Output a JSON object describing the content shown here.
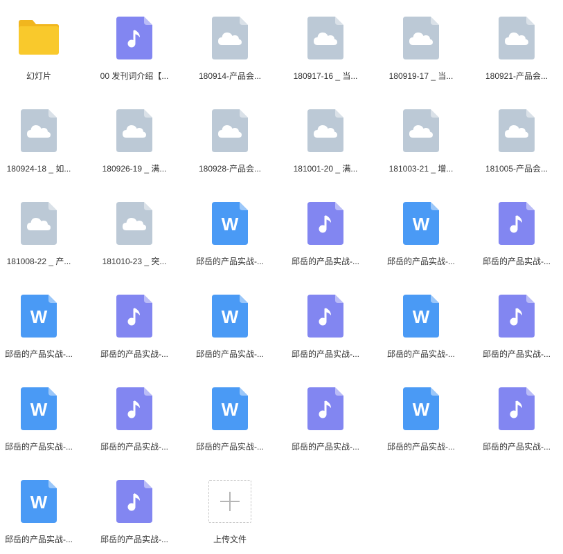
{
  "colors": {
    "folder": "#F9C92C",
    "folder_tab": "#F1B61E",
    "audio": "#8286F1",
    "word": "#4A9AF5",
    "unknown": "#BCC9D6"
  },
  "items": [
    {
      "label": "幻灯片",
      "type": "folder",
      "icon": "folder-icon"
    },
    {
      "label": "00 发刊词介绍【...",
      "type": "audio",
      "icon": "music-note-icon"
    },
    {
      "label": "180914-产品会...",
      "type": "unknown",
      "icon": "cloud-file-icon"
    },
    {
      "label": "180917-16 _ 当...",
      "type": "unknown",
      "icon": "cloud-file-icon"
    },
    {
      "label": "180919-17 _ 当...",
      "type": "unknown",
      "icon": "cloud-file-icon"
    },
    {
      "label": "180921-产品会...",
      "type": "unknown",
      "icon": "cloud-file-icon"
    },
    {
      "label": "180924-18 _ 如...",
      "type": "unknown",
      "icon": "cloud-file-icon"
    },
    {
      "label": "180926-19 _ 满...",
      "type": "unknown",
      "icon": "cloud-file-icon"
    },
    {
      "label": "180928-产品会...",
      "type": "unknown",
      "icon": "cloud-file-icon"
    },
    {
      "label": "181001-20 _ 满...",
      "type": "unknown",
      "icon": "cloud-file-icon"
    },
    {
      "label": "181003-21 _ 增...",
      "type": "unknown",
      "icon": "cloud-file-icon"
    },
    {
      "label": "181005-产品会...",
      "type": "unknown",
      "icon": "cloud-file-icon"
    },
    {
      "label": "181008-22 _ 产...",
      "type": "unknown",
      "icon": "cloud-file-icon"
    },
    {
      "label": "181010-23 _ 突...",
      "type": "unknown",
      "icon": "cloud-file-icon"
    },
    {
      "label": "邱岳的产品实战-...",
      "type": "word",
      "icon": "word-doc-icon"
    },
    {
      "label": "邱岳的产品实战-...",
      "type": "audio",
      "icon": "music-note-icon"
    },
    {
      "label": "邱岳的产品实战-...",
      "type": "word",
      "icon": "word-doc-icon"
    },
    {
      "label": "邱岳的产品实战-...",
      "type": "audio",
      "icon": "music-note-icon"
    },
    {
      "label": "邱岳的产品实战-...",
      "type": "word",
      "icon": "word-doc-icon"
    },
    {
      "label": "邱岳的产品实战-...",
      "type": "audio",
      "icon": "music-note-icon"
    },
    {
      "label": "邱岳的产品实战-...",
      "type": "word",
      "icon": "word-doc-icon"
    },
    {
      "label": "邱岳的产品实战-...",
      "type": "audio",
      "icon": "music-note-icon"
    },
    {
      "label": "邱岳的产品实战-...",
      "type": "word",
      "icon": "word-doc-icon"
    },
    {
      "label": "邱岳的产品实战-...",
      "type": "audio",
      "icon": "music-note-icon"
    },
    {
      "label": "邱岳的产品实战-...",
      "type": "word",
      "icon": "word-doc-icon"
    },
    {
      "label": "邱岳的产品实战-...",
      "type": "audio",
      "icon": "music-note-icon"
    },
    {
      "label": "邱岳的产品实战-...",
      "type": "word",
      "icon": "word-doc-icon"
    },
    {
      "label": "邱岳的产品实战-...",
      "type": "audio",
      "icon": "music-note-icon"
    },
    {
      "label": "邱岳的产品实战-...",
      "type": "word",
      "icon": "word-doc-icon"
    },
    {
      "label": "邱岳的产品实战-...",
      "type": "audio",
      "icon": "music-note-icon"
    },
    {
      "label": "邱岳的产品实战-...",
      "type": "word",
      "icon": "word-doc-icon"
    },
    {
      "label": "邱岳的产品实战-...",
      "type": "audio",
      "icon": "music-note-icon"
    },
    {
      "label": "上传文件",
      "type": "upload",
      "icon": "plus-icon"
    }
  ],
  "word_glyph": "W"
}
